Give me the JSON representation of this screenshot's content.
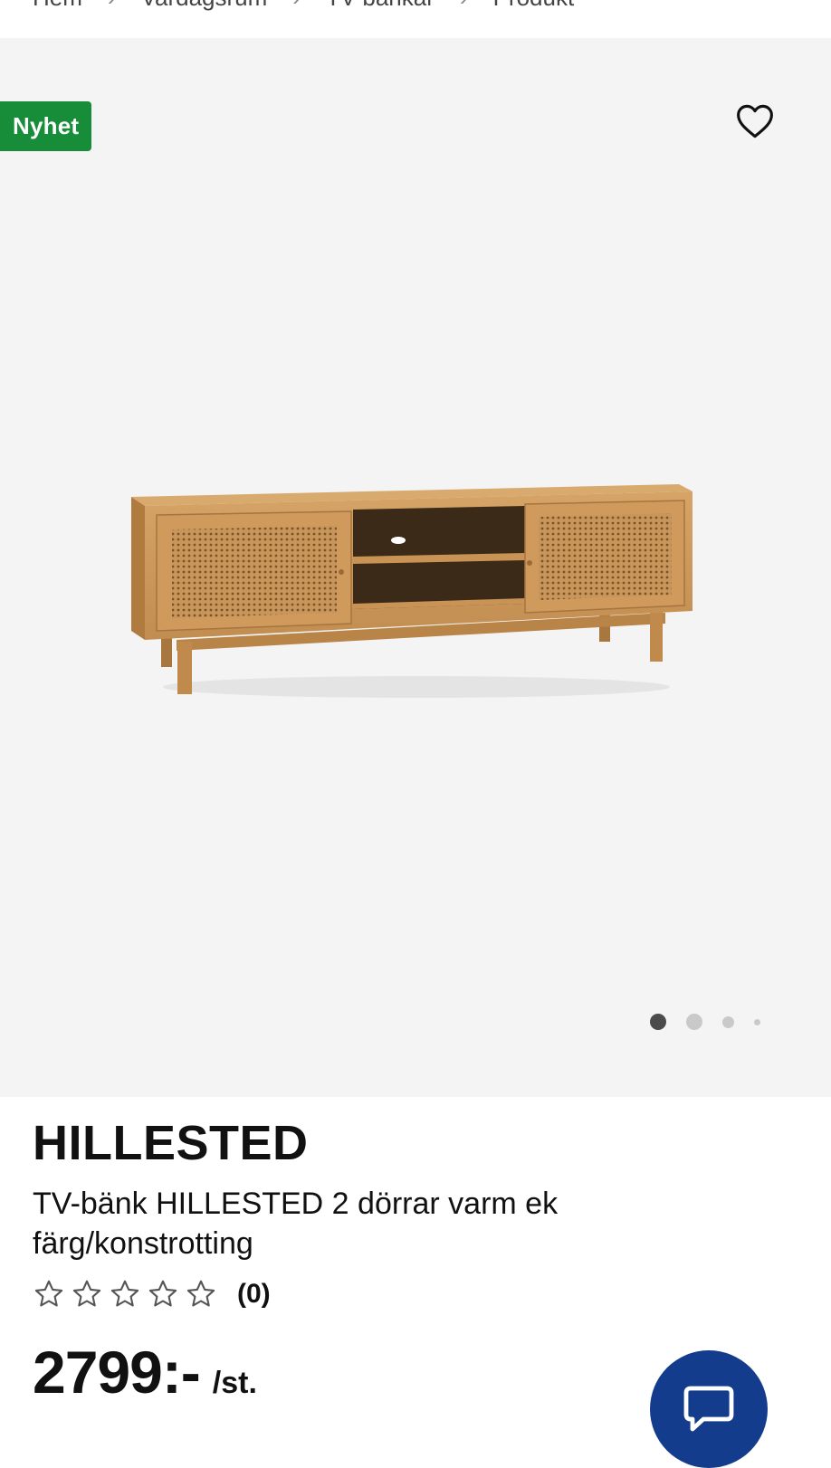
{
  "breadcrumb": {
    "items": [
      {
        "label": "Hem"
      },
      {
        "label": "Vardagsrum"
      },
      {
        "label": "TV-bänkar"
      },
      {
        "label": "Produkt"
      }
    ],
    "separator": "›"
  },
  "gallery": {
    "badge": {
      "label": "Nyhet",
      "color": "#178d3a"
    },
    "wishlist_icon": "heart-outline-icon",
    "image_description": "TV-bänk i ek med rottingdörrar",
    "pagination": {
      "total": 4,
      "active_index": 0
    }
  },
  "product": {
    "brand": "HILLESTED",
    "description": "TV-bänk HILLESTED 2 dörrar varm ek färg/konstrotting",
    "rating": {
      "stars": 0,
      "max": 5,
      "count_label": "(0)"
    },
    "price": {
      "value": "2799:-",
      "unit": "/st."
    }
  },
  "chat": {
    "icon": "chat-bubble-icon",
    "color": "#143c8c"
  }
}
